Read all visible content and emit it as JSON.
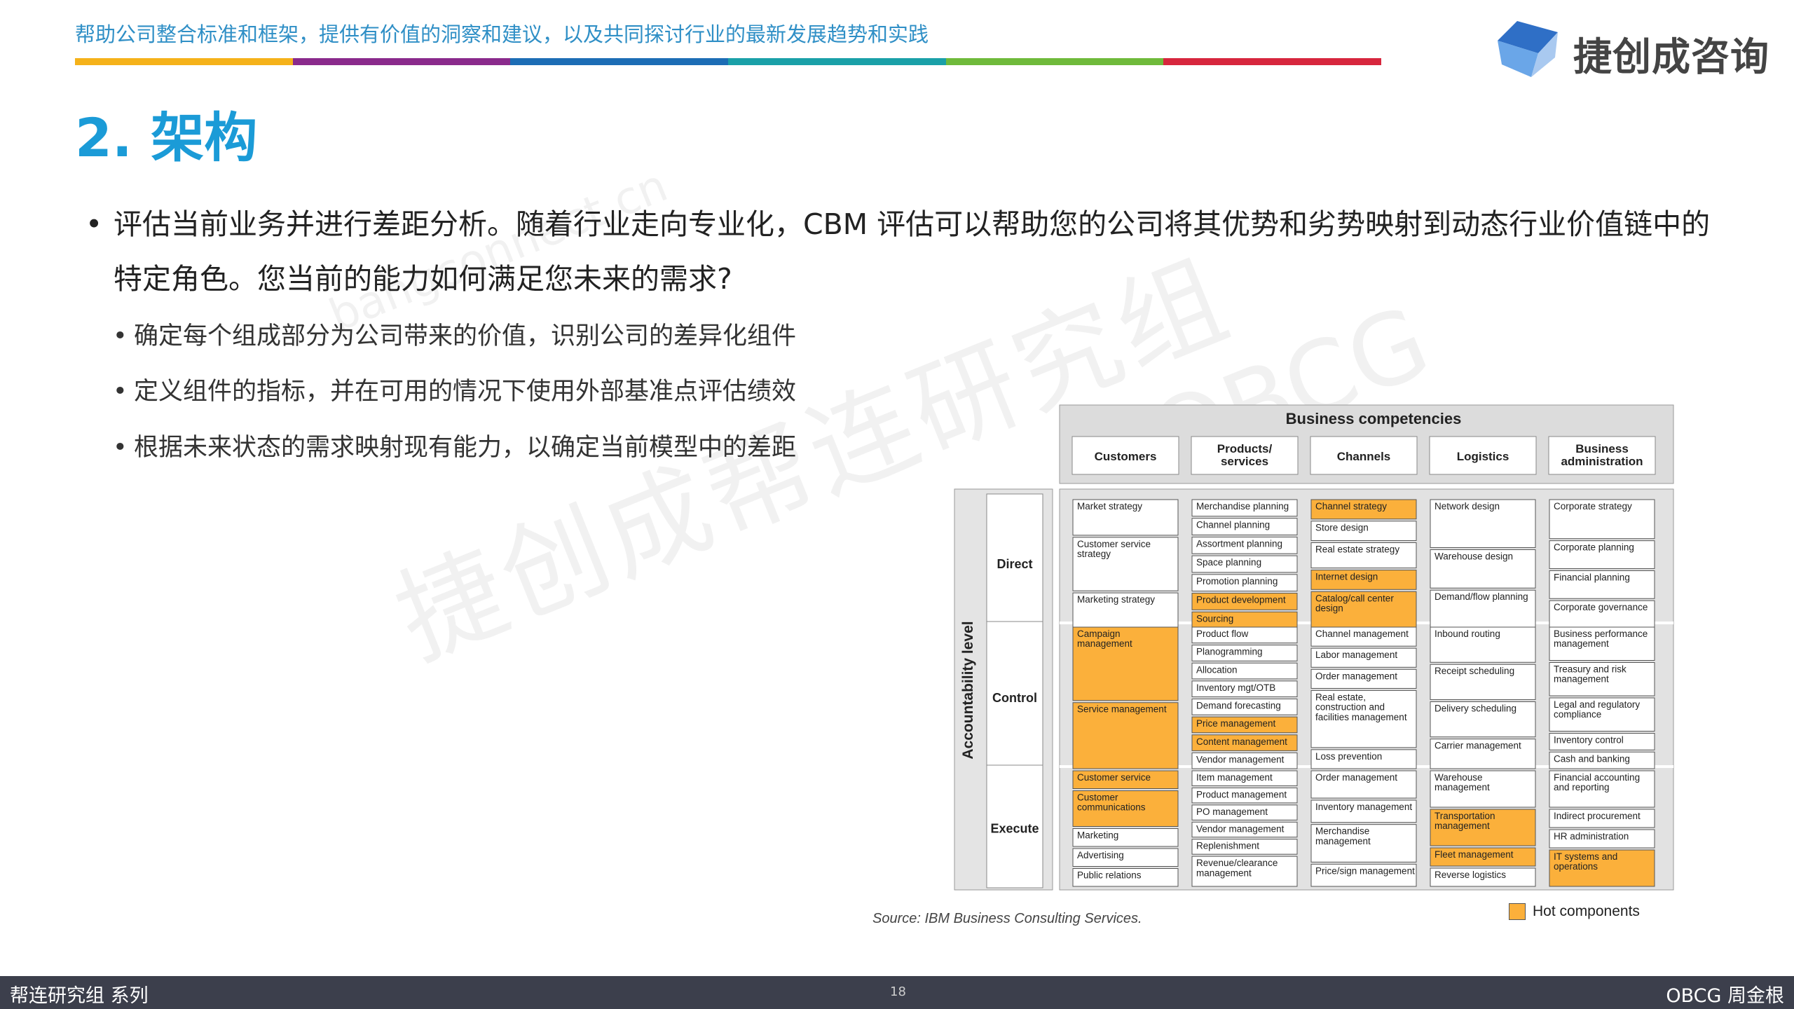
{
  "header": {
    "tagline": "帮助公司整合标准和框架，提供有价值的洞察和建议，以及共同探讨行业的最新发展趋势和实践",
    "stripe_colors": [
      "#f5b21a",
      "#8a2a8c",
      "#1c6db5",
      "#1aa0a8",
      "#6fba3b",
      "#d7263d"
    ],
    "logo_text": "捷创成咨询",
    "logo_colors": [
      "#2f6fc6",
      "#6aa6e8",
      "#a9c9f0"
    ]
  },
  "page_title": "2. 架构",
  "main_bullet": "评估当前业务并进行差距分析。随着行业走向专业化，CBM 评估可以帮助您的公司将其优势和劣势映射到动态行业价值链中的特定角色。您当前的能力如何满足您未来的需求?",
  "sub_bullets": [
    "确定每个组成部分为公司带来的价值，识别公司的差异化组件",
    "定义组件的指标，并在可用的情况下使用外部基准点评估绩效",
    "根据未来状态的需求映射现有能力，以确定当前模型中的差距"
  ],
  "watermarks": [
    "捷创成帮连研究组",
    "bangconnect.cn",
    "OBCG"
  ],
  "figure": {
    "title": "Business competencies",
    "columns": [
      "Customers",
      "Products/\nservices",
      "Channels",
      "Logistics",
      "Business\nadministration"
    ],
    "axis_label": "Accountability level",
    "rows": [
      "Direct",
      "Control",
      "Execute"
    ],
    "hot_color": "#fbb03b",
    "cells": [
      [
        [
          {
            "t": "Market strategy",
            "h": false,
            "w": 2
          },
          {
            "t": "Customer service\nstrategy",
            "h": false,
            "w": 3
          },
          {
            "t": "Marketing strategy",
            "h": false,
            "w": 2
          }
        ],
        [
          {
            "t": "Merchandise planning",
            "h": false
          },
          {
            "t": "Channel planning",
            "h": false
          },
          {
            "t": "Assortment planning",
            "h": false
          },
          {
            "t": "Space planning",
            "h": false
          },
          {
            "t": "Promotion planning",
            "h": false
          },
          {
            "t": "Product development",
            "h": true
          },
          {
            "t": "Sourcing",
            "h": true
          }
        ],
        [
          {
            "t": "Channel strategy",
            "h": true
          },
          {
            "t": "Store design",
            "h": false
          },
          {
            "t": "Real estate strategy",
            "h": false,
            "w": 1.3
          },
          {
            "t": "Internet design",
            "h": true
          },
          {
            "t": "Catalog/call center\ndesign",
            "h": true,
            "w": 1.9
          }
        ],
        [
          {
            "t": "Network design",
            "h": false,
            "w": 2
          },
          {
            "t": "Warehouse design",
            "h": false,
            "w": 1.6
          },
          {
            "t": "Demand/flow planning",
            "h": false,
            "w": 1.6
          }
        ],
        [
          {
            "t": "Corporate strategy",
            "h": false,
            "w": 1.4
          },
          {
            "t": "Corporate planning",
            "h": false
          },
          {
            "t": "Financial planning",
            "h": false
          },
          {
            "t": "Corporate governance",
            "h": false
          }
        ]
      ],
      [
        [
          {
            "t": "Campaign\nmanagement",
            "h": true,
            "w": 4
          },
          {
            "t": "Service management",
            "h": true,
            "w": 3.6
          }
        ],
        [
          {
            "t": "Product flow",
            "h": false
          },
          {
            "t": "Planogramming",
            "h": false
          },
          {
            "t": "Allocation",
            "h": false
          },
          {
            "t": "Inventory mgt/OTB",
            "h": false
          },
          {
            "t": "Demand forecasting",
            "h": false
          },
          {
            "t": "Price management",
            "h": true
          },
          {
            "t": "Content management",
            "h": true
          },
          {
            "t": "Vendor management",
            "h": false
          }
        ],
        [
          {
            "t": "Channel management",
            "h": false
          },
          {
            "t": "Labor management",
            "h": false
          },
          {
            "t": "Order management",
            "h": false
          },
          {
            "t": "Real estate,\nconstruction and\nfacilities management",
            "h": false,
            "w": 3
          },
          {
            "t": "Loss prevention",
            "h": false
          }
        ],
        [
          {
            "t": "Inbound routing",
            "h": false,
            "w": 1.9
          },
          {
            "t": "Receipt scheduling",
            "h": false,
            "w": 1.9
          },
          {
            "t": "Delivery scheduling",
            "h": false,
            "w": 1.9
          },
          {
            "t": "Carrier management",
            "h": false,
            "w": 1.6
          }
        ],
        [
          {
            "t": "Business performance\nmanagement",
            "h": false,
            "w": 2
          },
          {
            "t": "Treasury and risk\nmanagement",
            "h": false,
            "w": 2
          },
          {
            "t": "Legal and regulatory\ncompliance",
            "h": false,
            "w": 2
          },
          {
            "t": "Inventory control",
            "h": false
          },
          {
            "t": "Cash and banking",
            "h": false
          }
        ]
      ],
      [
        [
          {
            "t": "Customer service",
            "h": true
          },
          {
            "t": "Customer\ncommunications",
            "h": true,
            "w": 2
          },
          {
            "t": "Marketing",
            "h": false
          },
          {
            "t": "Advertising",
            "h": false
          },
          {
            "t": "Public relations",
            "h": false
          }
        ],
        [
          {
            "t": "Item management",
            "h": false
          },
          {
            "t": "Product management",
            "h": false
          },
          {
            "t": "PO management",
            "h": false
          },
          {
            "t": "Vendor management",
            "h": false
          },
          {
            "t": "Replenishment",
            "h": false
          },
          {
            "t": "Revenue/clearance\nmanagement",
            "h": false,
            "w": 2
          }
        ],
        [
          {
            "t": "Order management",
            "h": false,
            "w": 1.6
          },
          {
            "t": "Inventory management",
            "h": false,
            "w": 1.3
          },
          {
            "t": "Merchandise\nmanagement",
            "h": false,
            "w": 2.2
          },
          {
            "t": "Price/sign management",
            "h": false,
            "w": 1.3
          }
        ],
        [
          {
            "t": "Warehouse\nmanagement",
            "h": false,
            "w": 2
          },
          {
            "t": "Transportation\nmanagement",
            "h": true,
            "w": 2
          },
          {
            "t": "Fleet management",
            "h": true
          },
          {
            "t": "Reverse logistics",
            "h": false
          }
        ],
        [
          {
            "t": "Financial accounting\nand reporting",
            "h": false,
            "w": 2
          },
          {
            "t": "Indirect procurement",
            "h": false
          },
          {
            "t": "HR administration",
            "h": false
          },
          {
            "t": "IT systems and\noperations",
            "h": true,
            "w": 2
          }
        ]
      ]
    ]
  },
  "source_note": "Source: IBM Business Consulting Services.",
  "legend_label": "Hot components",
  "footer": {
    "left": "帮连研究组 系列",
    "page_number": "18",
    "right": "OBCG 周金根"
  }
}
